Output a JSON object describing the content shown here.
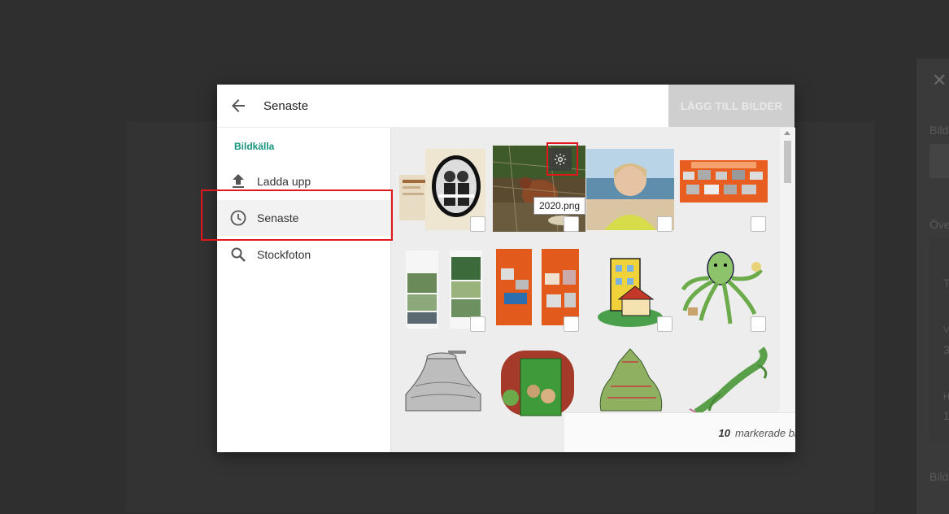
{
  "header": {
    "title": "Senaste",
    "add_button": "LÄGG TILL BILDER"
  },
  "sidebar": {
    "title": "Bildkälla",
    "items": [
      {
        "label": "Ladda upp",
        "icon": "upload-icon"
      },
      {
        "label": "Senaste",
        "icon": "clock-icon",
        "active": true
      },
      {
        "label": "Stockfoton",
        "icon": "search-icon"
      }
    ]
  },
  "gallery": {
    "tooltip": "2020.png",
    "selected_count": "10",
    "selected_label": "markerade bilder"
  },
  "background": {
    "labels": [
      "Bild",
      "Öve",
      "T",
      "V",
      "3",
      "H",
      "1",
      "Bild"
    ]
  },
  "colors": {
    "accent": "#17947f",
    "highlight": "#e0161b",
    "add_button_bg": "#cfcfcf"
  }
}
